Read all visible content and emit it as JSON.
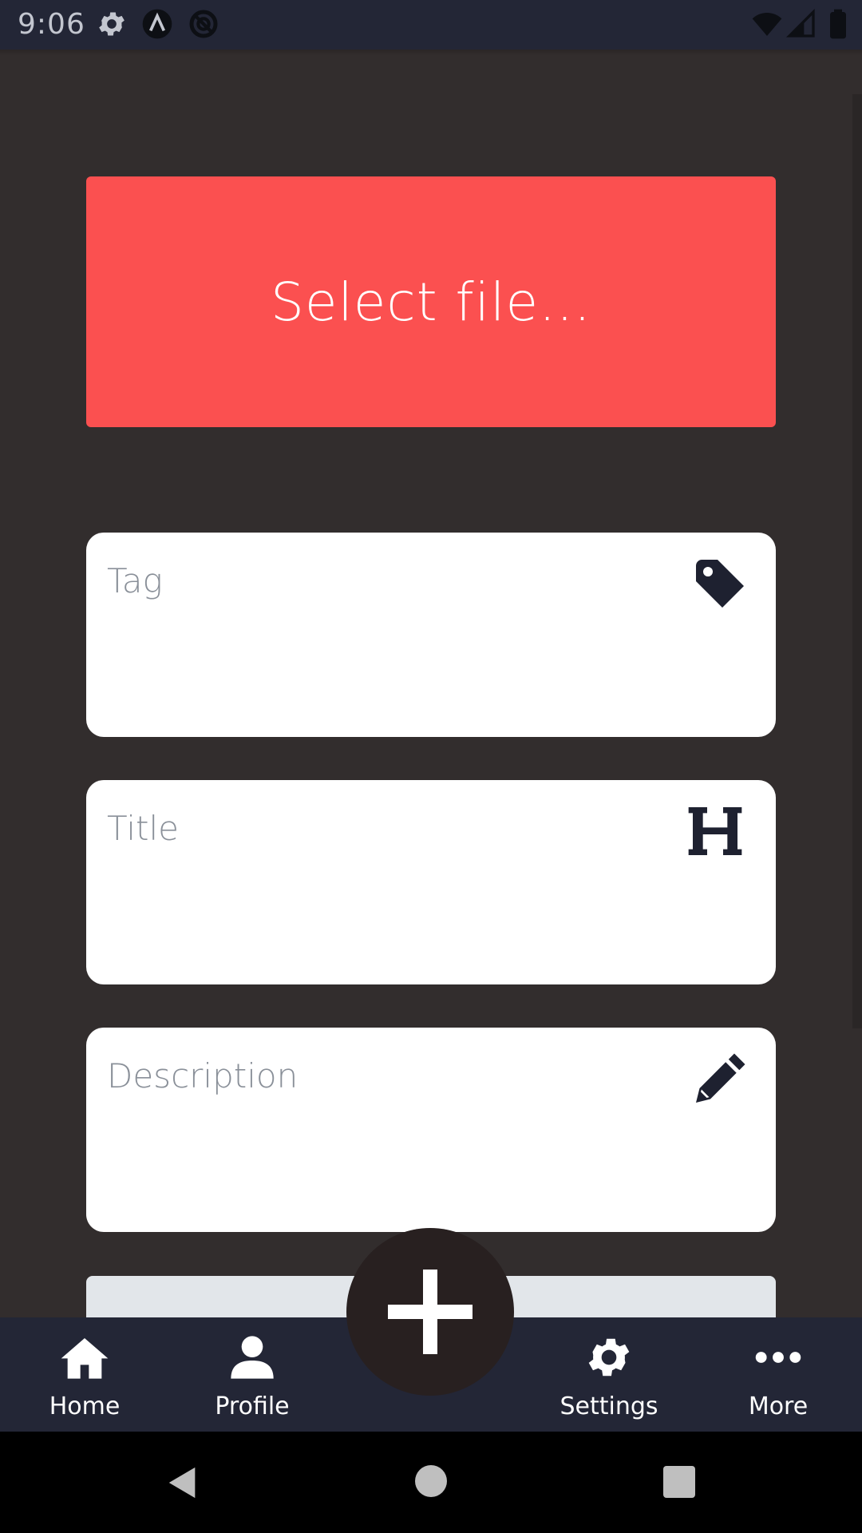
{
  "status_bar": {
    "time": "9:06",
    "left_icons": [
      "gear-icon",
      "a-circle-icon",
      "no-sign-icon"
    ],
    "right_icons": [
      "wifi-icon",
      "cell-signal-icon",
      "battery-icon"
    ]
  },
  "main": {
    "select_file_label": "Select file...",
    "select_file_color": "#fb5050",
    "fields": [
      {
        "placeholder": "Tag",
        "icon": "tag-icon"
      },
      {
        "placeholder": "Title",
        "icon": "heading-icon"
      },
      {
        "placeholder": "Description",
        "icon": "pencil-icon"
      }
    ]
  },
  "bottom_nav": {
    "items": [
      {
        "label": "Home",
        "icon": "home-icon"
      },
      {
        "label": "Profile",
        "icon": "person-icon"
      },
      {
        "label": "Settings",
        "icon": "gear-icon"
      },
      {
        "label": "More",
        "icon": "more-dots-icon"
      }
    ],
    "fab_icon": "plus-icon"
  },
  "system_nav": {
    "icons": [
      "back-icon",
      "home-circle-icon",
      "recents-icon"
    ]
  },
  "colors": {
    "background": "#322d2d",
    "bars": "#232636",
    "fab": "#282020",
    "placeholder": "#8a9099"
  }
}
